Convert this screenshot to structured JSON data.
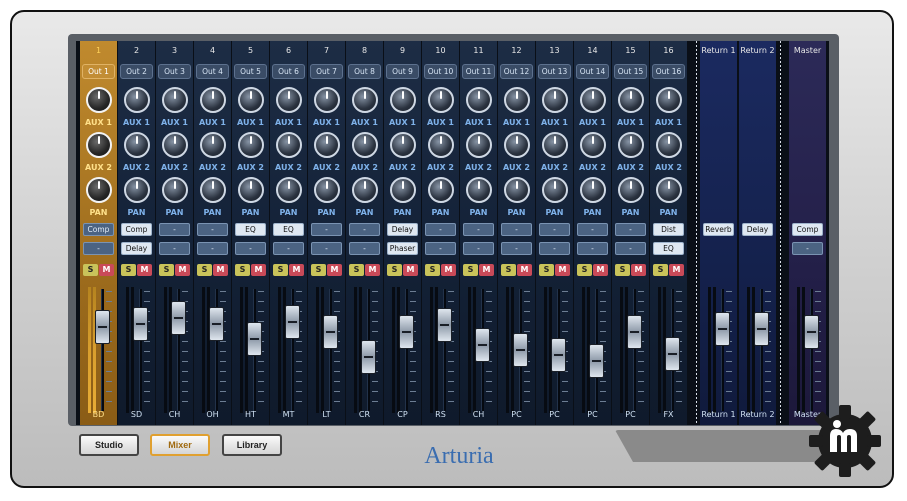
{
  "channels": [
    {
      "num": "1",
      "out": "Out 1",
      "fx1": "Comp",
      "fx1_on": false,
      "fx2": "-",
      "name": "BD",
      "selected": true,
      "fader": 0.76
    },
    {
      "num": "2",
      "out": "Out 2",
      "fx1": "Comp",
      "fx1_on": true,
      "fx2": "Delay",
      "fx2_on": true,
      "name": "SD",
      "fader": 0.8
    },
    {
      "num": "3",
      "out": "Out 3",
      "fx1": "-",
      "fx2": "-",
      "name": "CH",
      "fader": 0.86
    },
    {
      "num": "4",
      "out": "Out 4",
      "fx1": "-",
      "fx2": "-",
      "name": "OH",
      "fader": 0.8
    },
    {
      "num": "5",
      "out": "Out 5",
      "fx1": "EQ",
      "fx1_on": true,
      "fx2": "-",
      "name": "HT",
      "fader": 0.62
    },
    {
      "num": "6",
      "out": "Out 6",
      "fx1": "EQ",
      "fx1_on": true,
      "fx2": "-",
      "name": "MT",
      "fader": 0.82
    },
    {
      "num": "7",
      "out": "Out 7",
      "fx1": "-",
      "fx2": "-",
      "name": "LT",
      "fader": 0.7
    },
    {
      "num": "8",
      "out": "Out 8",
      "fx1": "-",
      "fx2": "-",
      "name": "CR",
      "fader": 0.42
    },
    {
      "num": "9",
      "out": "Out 9",
      "fx1": "Delay",
      "fx1_on": true,
      "fx2": "Phaser",
      "fx2_on": true,
      "name": "CP",
      "fader": 0.7
    },
    {
      "num": "10",
      "out": "Out 10",
      "fx1": "-",
      "fx2": "-",
      "name": "RS",
      "fader": 0.78
    },
    {
      "num": "11",
      "out": "Out 11",
      "fx1": "-",
      "fx2": "-",
      "name": "CH",
      "fader": 0.56
    },
    {
      "num": "12",
      "out": "Out 12",
      "fx1": "-",
      "fx2": "-",
      "name": "PC",
      "fader": 0.5
    },
    {
      "num": "13",
      "out": "Out 13",
      "fx1": "-",
      "fx2": "-",
      "name": "PC",
      "fader": 0.44
    },
    {
      "num": "14",
      "out": "Out 14",
      "fx1": "-",
      "fx2": "-",
      "name": "PC",
      "fader": 0.38
    },
    {
      "num": "15",
      "out": "Out 15",
      "fx1": "-",
      "fx2": "-",
      "name": "PC",
      "fader": 0.7
    },
    {
      "num": "16",
      "out": "Out 16",
      "fx1": "Dist",
      "fx1_on": true,
      "fx2": "EQ",
      "fx2_on": true,
      "name": "FX",
      "fader": 0.46
    }
  ],
  "returns": [
    {
      "num": "Return 1",
      "fx1": "Reverb",
      "name": "Return 1",
      "fader": 0.74
    },
    {
      "num": "Return 2",
      "fx1": "Delay",
      "name": "Return 2",
      "fader": 0.74
    }
  ],
  "master": {
    "num": "Master",
    "fx1": "Comp",
    "fx2": "-",
    "name": "Master",
    "fader": 0.7
  },
  "labels": {
    "aux1": "AUX 1",
    "aux2": "AUX 2",
    "pan": "PAN",
    "solo": "S",
    "mute": "M"
  },
  "nav": {
    "studio": "Studio",
    "mixer": "Mixer",
    "library": "Library",
    "active": "mixer"
  },
  "brand": "Arturia"
}
